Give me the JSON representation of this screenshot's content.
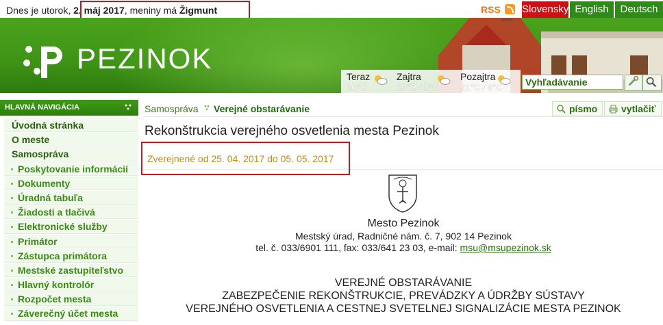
{
  "topbar": {
    "date_prefix": "Dnes je utorok, ",
    "date": "2. máj 2017",
    "name_prefix": ", meniny má ",
    "name_day": "Žigmunt",
    "rss_label": "RSS",
    "languages": [
      "Slovensky",
      "English",
      "Deutsch"
    ],
    "active_language_color": "#cc1018",
    "language_color": "#2f8a1a"
  },
  "banner": {
    "logo_text": "PEZINOK",
    "weather": [
      {
        "day": "Teraz",
        "temp": "16°C"
      },
      {
        "day": "Zajtra",
        "temp": "19°C / 8°C"
      },
      {
        "day": "Pozajtra",
        "temp": "21°C / 8°C"
      }
    ],
    "search_placeholder": "Vyhľadávanie",
    "icons": [
      "weather-sun-cloud-icon",
      "search-icon",
      "tools-icon"
    ]
  },
  "sidebar": {
    "heading": "HLAVNÁ NAVIGÁCIA",
    "items": [
      {
        "label": "Úvodná stránka",
        "level": 0
      },
      {
        "label": "O meste",
        "level": 0
      },
      {
        "label": "Samospráva",
        "level": 0
      },
      {
        "label": "Poskytovanie informácií",
        "level": 1
      },
      {
        "label": "Dokumenty",
        "level": 1
      },
      {
        "label": "Úradná tabuľa",
        "level": 1
      },
      {
        "label": "Žiadosti a tlačivá",
        "level": 1
      },
      {
        "label": "Elektronické služby",
        "level": 1
      },
      {
        "label": "Primátor",
        "level": 1
      },
      {
        "label": "Zástupca primátora",
        "level": 1
      },
      {
        "label": "Mestské zastupiteľstvo",
        "level": 1
      },
      {
        "label": "Hlavný kontrolór",
        "level": 1
      },
      {
        "label": "Rozpočet mesta",
        "level": 1
      },
      {
        "label": "Záverečný účet mesta",
        "level": 1
      }
    ]
  },
  "breadcrumb": {
    "parent": "Samospráva",
    "current": "Verejné obstarávanie"
  },
  "tools": {
    "font_label": "písmo",
    "print_label": "vytlačiť"
  },
  "article": {
    "title": "Rekonštrukcia verejného osvetlenia mesta Pezinok",
    "published": "Zverejnené od 25. 04. 2017 do 05. 05. 2017",
    "org": "Mesto Pezinok",
    "address": "Mestský úrad, Radničné nám. č. 7, 902 14 Pezinok",
    "contact_prefix": "tel. č. 033/6901 111, fax: 033/641 23 03, e-mail: ",
    "email": "msu@msupezinok.sk",
    "heading1": "VEREJNÉ OBSTARÁVANIE",
    "heading2": "ZABEZPEČENIE REKONŠTRUKCIE, PREVÁDZKY A ÚDRŽBY SÚSTAVY",
    "heading3": "VEREJNÉHO OSVETLENIA A CESTNEJ SVETELNEJ SIGNALIZÁCIE MESTA PEZINOK"
  },
  "highlight_color": "#c4161c"
}
